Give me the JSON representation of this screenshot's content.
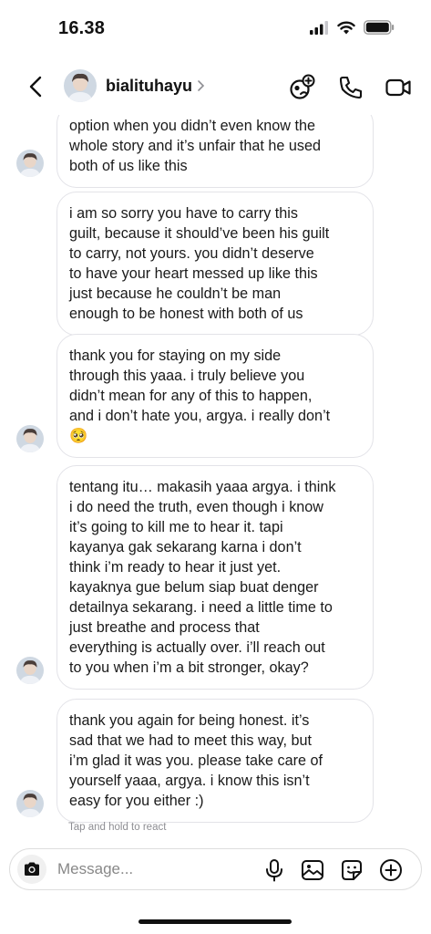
{
  "status_bar": {
    "time": "16.38"
  },
  "header": {
    "username": "bialituhayu",
    "icons": [
      "back-arrow-icon",
      "chevron-right-icon",
      "add-member-icon",
      "phone-icon",
      "video-camera-icon"
    ]
  },
  "messages": [
    "option when you didn’t even know the\nwhole story and it’s unfair that he used\nboth of us like this",
    "i am so sorry you have to carry this\nguilt, because it should’ve been his guilt\nto carry, not yours. you didn’t deserve\nto have your heart messed up like this\njust because he couldn’t be man\nenough to be honest with both of us",
    "thank you for staying on my side\nthrough this yaaa. i truly believe you\ndidn’t mean for any of this to happen,\nand i don’t hate you, argya. i really don’t\n🥺",
    "tentang itu… makasih yaaa argya. i think\ni do need the truth, even though i know\nit’s going to kill me to hear it. tapi\nkayanya gak sekarang karna i don’t\nthink i’m ready to hear it just yet.\nkayaknya gue belum siap buat denger\ndetailnya sekarang. i need a little time to\njust breathe and process that\neverything is actually over. i’ll reach out\nto you when i’m a bit stronger, okay?",
    "thank you again for being honest. it’s\nsad that we had to meet this way, but\ni’m glad it was you. please take care of\nyourself yaaa, argya. i know this isn’t\neasy for you either :)"
  ],
  "react_hint": "Tap and hold to react",
  "composer": {
    "placeholder": "Message...",
    "icons": [
      "camera-icon",
      "microphone-icon",
      "gallery-icon",
      "sticker-icon",
      "plus-icon"
    ]
  },
  "colors": {
    "text": "#111111",
    "bubble_border": "#e3e3e8",
    "muted": "#8e8e93"
  }
}
